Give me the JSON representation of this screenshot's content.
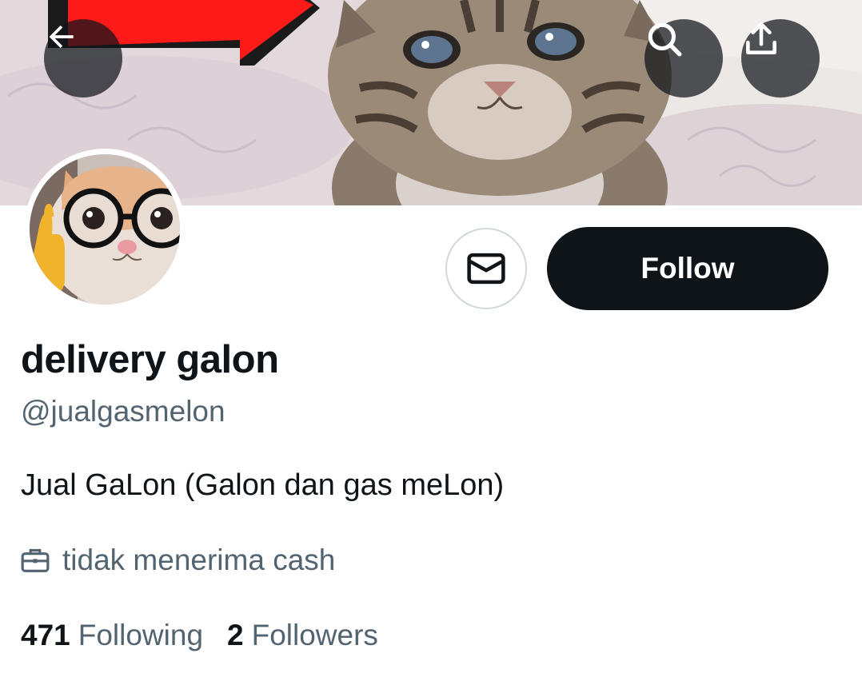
{
  "header": {
    "banner_image": "tabby-kitten-photo",
    "back_icon": "arrow-left-icon",
    "search_icon": "search-icon",
    "share_icon": "share-upload-icon"
  },
  "profile": {
    "avatar_image": "cat-with-glasses-photo",
    "display_name": "delivery galon",
    "handle": "@jualgasmelon",
    "bio": "Jual GaLon (Galon dan gas meLon)",
    "professional_category": "tidak menerima cash",
    "category_icon": "briefcase-icon"
  },
  "actions": {
    "message_icon": "envelope-icon",
    "follow_label": "Follow"
  },
  "stats": {
    "following_count": "471",
    "following_label": "Following",
    "followers_count": "2",
    "followers_label": "Followers"
  },
  "colors": {
    "primary_text": "#0f1419",
    "secondary_text": "#536471",
    "button_dark": "#0f1419",
    "border": "#cfd9de",
    "banner_arrow": "#ff1a1a"
  }
}
